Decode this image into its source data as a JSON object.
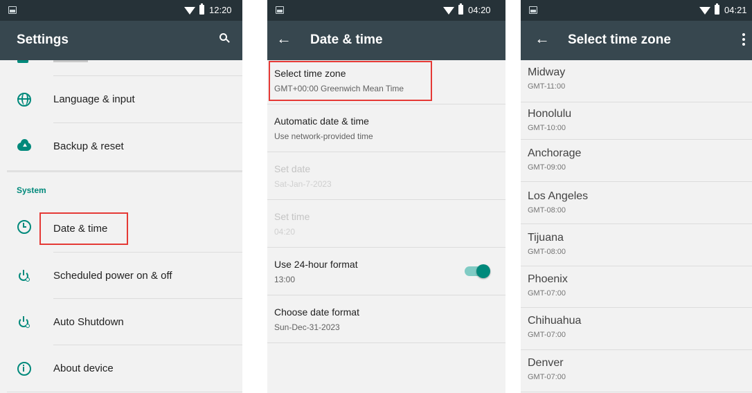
{
  "panels": {
    "settings": {
      "status_time": "12:20",
      "title": "Settings",
      "items": [
        {
          "label": "Language & input"
        },
        {
          "label": "Backup & reset"
        },
        {
          "label": "Date & time"
        },
        {
          "label": "Scheduled power on & off"
        },
        {
          "label": "Auto Shutdown"
        },
        {
          "label": "About device"
        }
      ],
      "section_system": "System"
    },
    "date_time": {
      "status_time": "04:20",
      "title": "Date & time",
      "rows": [
        {
          "title": "Select time zone",
          "subtitle": "GMT+00:00 Greenwich Mean Time",
          "enabled": true
        },
        {
          "title": "Automatic date & time",
          "subtitle": "Use network-provided time",
          "enabled": true
        },
        {
          "title": "Set date",
          "subtitle": "Sat-Jan-7-2023",
          "enabled": false
        },
        {
          "title": "Set time",
          "subtitle": "04:20",
          "enabled": false
        },
        {
          "title": "Use 24-hour format",
          "subtitle": "13:00",
          "enabled": true,
          "toggle_on": true
        },
        {
          "title": "Choose date format",
          "subtitle": "Sun-Dec-31-2023",
          "enabled": true
        }
      ]
    },
    "time_zone": {
      "status_time": "04:21",
      "title": "Select time zone",
      "zones": [
        {
          "city": "Midway",
          "gmt": "GMT-11:00"
        },
        {
          "city": "Honolulu",
          "gmt": "GMT-10:00"
        },
        {
          "city": "Anchorage",
          "gmt": "GMT-09:00"
        },
        {
          "city": "Los Angeles",
          "gmt": "GMT-08:00"
        },
        {
          "city": "Tijuana",
          "gmt": "GMT-08:00"
        },
        {
          "city": "Phoenix",
          "gmt": "GMT-07:00"
        },
        {
          "city": "Chihuahua",
          "gmt": "GMT-07:00"
        },
        {
          "city": "Denver",
          "gmt": "GMT-07:00"
        }
      ]
    }
  },
  "colors": {
    "status_bar": "#263238",
    "app_bar": "#37474f",
    "accent": "#00897b",
    "highlight": "#e53935"
  }
}
